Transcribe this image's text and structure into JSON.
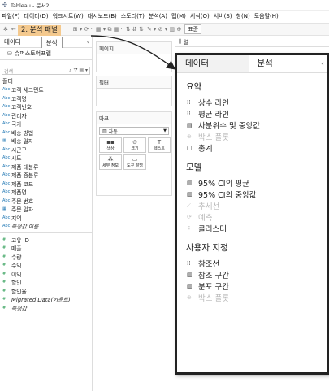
{
  "window": {
    "title": "Tableau - 문서2"
  },
  "menu": [
    "파일(F)",
    "데이터(D)",
    "워크시트(W)",
    "대시보드(B)",
    "스토리(T)",
    "분석(A)",
    "맵(M)",
    "서식(O)",
    "서버(S)",
    "창(N)",
    "도움말(H)"
  ],
  "toolbar": {
    "format_label": "표준",
    "step_label": "2. 분석 패널"
  },
  "left_pane": {
    "tab_data": "데이터",
    "tab_analytics": "분석",
    "datasource": "슈퍼스토어프랩",
    "search_placeholder": "검색",
    "folder": "폴더",
    "dimensions": [
      {
        "type": "Abc",
        "label": "고객 세그먼트"
      },
      {
        "type": "Abc",
        "label": "고객명"
      },
      {
        "type": "Abc",
        "label": "고객번호"
      },
      {
        "type": "Abc",
        "label": "관리자"
      },
      {
        "type": "Abc",
        "label": "국가"
      },
      {
        "type": "Abc",
        "label": "배송 방법"
      },
      {
        "type": "▦",
        "label": "배송 일자"
      },
      {
        "type": "Abc",
        "label": "시군구"
      },
      {
        "type": "Abc",
        "label": "시도"
      },
      {
        "type": "Abc",
        "label": "제품 대분류"
      },
      {
        "type": "Abc",
        "label": "제품 중분류"
      },
      {
        "type": "Abc",
        "label": "제품 코드"
      },
      {
        "type": "Abc",
        "label": "제품명"
      },
      {
        "type": "Abc",
        "label": "주문 번호"
      },
      {
        "type": "▦",
        "label": "주문 일자"
      },
      {
        "type": "Abc",
        "label": "지역"
      },
      {
        "type": "Abc",
        "label": "측정값 이름",
        "italic": true
      }
    ],
    "measures": [
      {
        "type": "#",
        "label": "고유 ID"
      },
      {
        "type": "#",
        "label": "매출"
      },
      {
        "type": "#",
        "label": "수량"
      },
      {
        "type": "#",
        "label": "수익"
      },
      {
        "type": "#",
        "label": "이익"
      },
      {
        "type": "#",
        "label": "할인"
      },
      {
        "type": "#",
        "label": "할인율"
      },
      {
        "type": "#",
        "label": "Migrated Data(카운트)",
        "italic": true
      },
      {
        "type": "#",
        "label": "측정값",
        "italic": true
      }
    ]
  },
  "shelves": {
    "pages": "페이지",
    "filters": "필터",
    "marks": "마크",
    "marks_type": "자동",
    "columns": "열",
    "mark_buttons": [
      "색상",
      "크기",
      "텍스트",
      "세부 정보",
      "도구 설명"
    ]
  },
  "analytics_panel": {
    "tab_data": "데이터",
    "tab_analytics": "분석",
    "sections": [
      {
        "title": "요약",
        "items": [
          {
            "icon": "constant-line-icon",
            "glyph": "⁞⁞",
            "label": "상수 라인",
            "disabled": false
          },
          {
            "icon": "average-line-icon",
            "glyph": "⁞⁞",
            "label": "평균 라인",
            "disabled": false
          },
          {
            "icon": "median-quartile-icon",
            "glyph": "▤",
            "label": "사분위수 및 중앙값",
            "disabled": false
          },
          {
            "icon": "box-plot-icon",
            "glyph": "⊕",
            "label": "박스 플롯",
            "disabled": true
          },
          {
            "icon": "totals-icon",
            "glyph": "▢",
            "label": "총계",
            "disabled": false
          }
        ]
      },
      {
        "title": "모델",
        "items": [
          {
            "icon": "ci-mean-icon",
            "glyph": "▥",
            "label": "95% CI의 평균",
            "disabled": false
          },
          {
            "icon": "ci-median-icon",
            "glyph": "▥",
            "label": "95% CI의 중앙값",
            "disabled": false
          },
          {
            "icon": "trend-line-icon",
            "glyph": "⟋",
            "label": "추세선",
            "disabled": true
          },
          {
            "icon": "forecast-icon",
            "glyph": "⟳",
            "label": "예측",
            "disabled": true
          },
          {
            "icon": "cluster-icon",
            "glyph": "⁘",
            "label": "클러스터",
            "disabled": false
          }
        ]
      },
      {
        "title": "사용자 지정",
        "items": [
          {
            "icon": "reference-line-icon",
            "glyph": "⁞⁞",
            "label": "참조선",
            "disabled": false
          },
          {
            "icon": "reference-band-icon",
            "glyph": "▥",
            "label": "참조 구간",
            "disabled": false
          },
          {
            "icon": "distribution-band-icon",
            "glyph": "▥",
            "label": "분포 구간",
            "disabled": false
          },
          {
            "icon": "box-plot-icon",
            "glyph": "⊕",
            "label": "박스 플롯",
            "disabled": true
          }
        ]
      }
    ]
  },
  "colors": {
    "highlight": "#f4c98e",
    "panel_border": "#222222",
    "dimension_icon": "#1f77b4",
    "measure_icon": "#2e9e57"
  }
}
